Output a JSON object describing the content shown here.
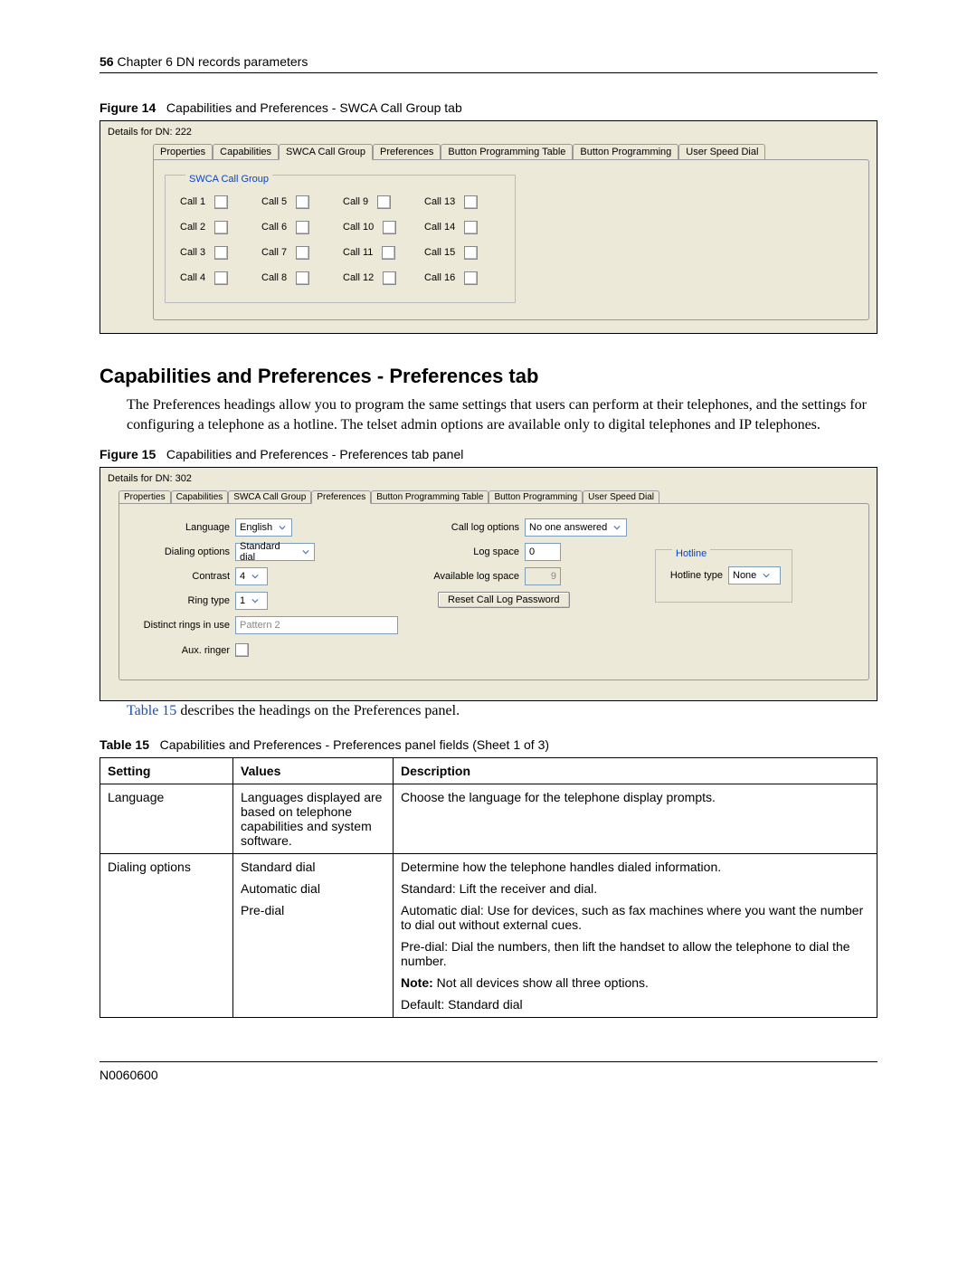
{
  "header": {
    "page_number": "56",
    "chapter": "Chapter 6  DN records parameters"
  },
  "figure14": {
    "label": "Figure 14",
    "title": "Capabilities and Preferences - SWCA Call Group tab",
    "details_for": "Details for DN: 222",
    "tabs": [
      "Properties",
      "Capabilities",
      "SWCA Call Group",
      "Preferences",
      "Button Programming Table",
      "Button Programming",
      "User Speed Dial"
    ],
    "active_tab": "SWCA Call Group",
    "group_label": "SWCA Call Group",
    "calls": [
      "Call 1",
      "Call 2",
      "Call 3",
      "Call 4",
      "Call 5",
      "Call 6",
      "Call 7",
      "Call 8",
      "Call 9",
      "Call 10",
      "Call 11",
      "Call 12",
      "Call 13",
      "Call 14",
      "Call 15",
      "Call 16"
    ]
  },
  "section_heading": "Capabilities and Preferences - Preferences tab",
  "section_body": "The Preferences headings allow you to program the same settings that users can perform at their telephones, and the settings for configuring a telephone as a hotline. The telset admin options are available only to digital telephones and IP telephones.",
  "figure15": {
    "label": "Figure 15",
    "title": "Capabilities and Preferences - Preferences tab panel",
    "details_for": "Details for DN: 302",
    "tabs": [
      "Properties",
      "Capabilities",
      "SWCA Call Group",
      "Preferences",
      "Button Programming Table",
      "Button Programming",
      "User Speed Dial"
    ],
    "active_tab": "Preferences",
    "fields": {
      "language_label": "Language",
      "language_value": "English",
      "dialing_label": "Dialing options",
      "dialing_value": "Standard dial",
      "contrast_label": "Contrast",
      "contrast_value": "4",
      "ringtype_label": "Ring type",
      "ringtype_value": "1",
      "distinct_label": "Distinct rings in use",
      "distinct_value": "Pattern 2",
      "aux_label": "Aux. ringer",
      "calllog_label": "Call log options",
      "calllog_value": "No one answered",
      "logspace_label": "Log space",
      "logspace_value": "0",
      "avail_label": "Available log space",
      "avail_value": "9",
      "reset_button": "Reset Call Log Password",
      "hotline_group": "Hotline",
      "hotline_type_label": "Hotline type",
      "hotline_type_value": "None"
    }
  },
  "link_text": "Table 15",
  "link_suffix": " describes the headings on the Preferences panel.",
  "table15": {
    "label": "Table 15",
    "title": "Capabilities and Preferences - Preferences panel fields (Sheet 1 of 3)",
    "headers": [
      "Setting",
      "Values",
      "Description"
    ],
    "rows": [
      {
        "setting": "Language",
        "values": "Languages displayed are based on telephone capabilities and system software.",
        "description": [
          "Choose the language for the telephone display prompts."
        ]
      },
      {
        "setting": "Dialing options",
        "values_list": [
          "Standard dial",
          "Automatic dial",
          "Pre-dial"
        ],
        "description": [
          "Determine how the telephone handles dialed information.",
          "Standard: Lift the receiver and dial.",
          "Automatic dial: Use for devices, such as fax machines where you want the number to dial out without external cues.",
          "Pre-dial: Dial the numbers, then lift the handset to allow the telephone to dial the number.",
          "<b>Note:</b> Not all devices show all three options.",
          "Default: Standard dial"
        ]
      }
    ]
  },
  "footer": {
    "doc_id": "N0060600"
  }
}
